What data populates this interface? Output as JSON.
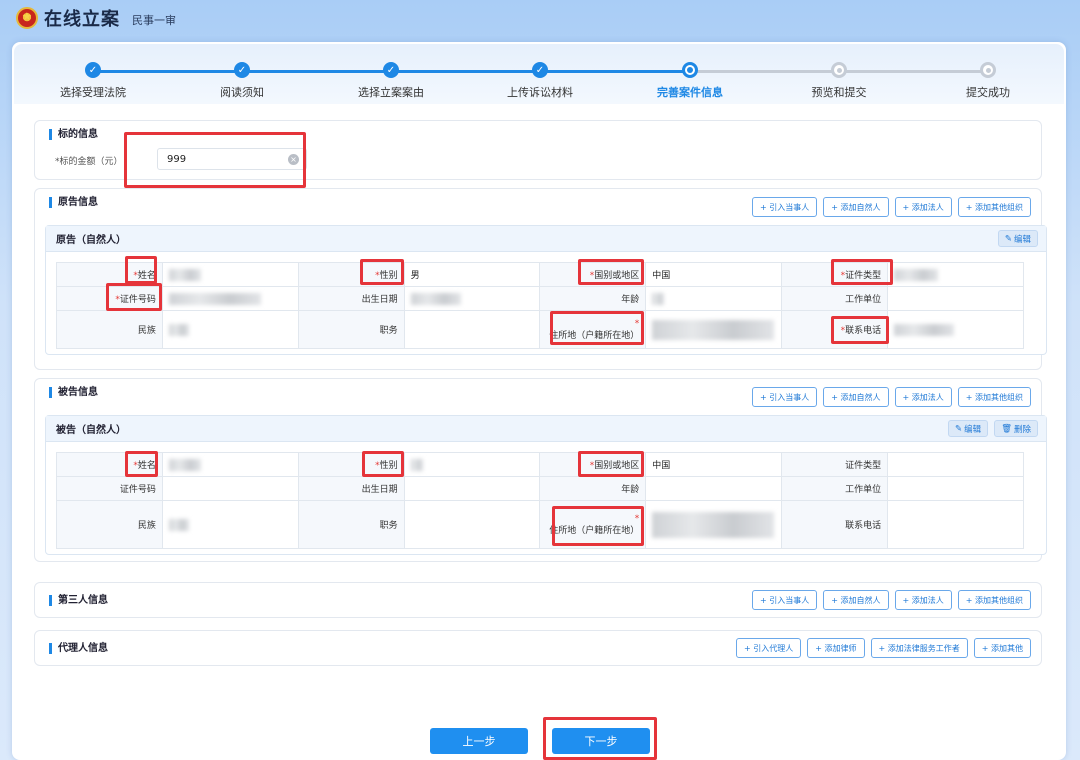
{
  "header": {
    "title": "在线立案",
    "subtitle": "民事一审"
  },
  "steps": [
    {
      "label": "选择受理法院",
      "state": "done"
    },
    {
      "label": "阅读须知",
      "state": "done"
    },
    {
      "label": "选择立案案由",
      "state": "done"
    },
    {
      "label": "上传诉讼材料",
      "state": "done"
    },
    {
      "label": "完善案件信息",
      "state": "current"
    },
    {
      "label": "预览和提交",
      "state": "todo"
    },
    {
      "label": "提交成功",
      "state": "todo"
    }
  ],
  "subject": {
    "title": "标的信息",
    "amount_label": "*标的金额（元）",
    "amount_value": "999"
  },
  "party_buttons": {
    "import": "+ 引入当事人",
    "add_natural": "+ 添加自然人",
    "add_legal": "+ 添加法人",
    "add_org": "+ 添加其他组织"
  },
  "plaintiff": {
    "section_title": "原告信息",
    "card_title": "原告（自然人）",
    "edit": "编辑",
    "labels": {
      "name": "姓名",
      "gender": "性别",
      "country": "国别或地区",
      "id_type": "证件类型",
      "id_no": "证件号码",
      "birth": "出生日期",
      "age": "年龄",
      "work": "工作单位",
      "ethnic": "民族",
      "job": "职务",
      "address": "住所地（户籍所在地）",
      "phone": "联系电话"
    },
    "values": {
      "gender": "男",
      "country": "中国"
    }
  },
  "defendant": {
    "section_title": "被告信息",
    "card_title": "被告（自然人）",
    "edit": "编辑",
    "delete": "删除",
    "labels": {
      "name": "姓名",
      "gender": "性别",
      "country": "国别或地区",
      "id_type": "证件类型",
      "id_no": "证件号码",
      "birth": "出生日期",
      "age": "年龄",
      "work": "工作单位",
      "ethnic": "民族",
      "job": "职务",
      "address": "住所地（户籍所在地）",
      "phone": "联系电话"
    },
    "values": {
      "country": "中国"
    }
  },
  "third_party": {
    "title": "第三人信息"
  },
  "agent": {
    "title": "代理人信息",
    "buttons": {
      "import": "+ 引入代理人",
      "lawyer": "+ 添加律师",
      "legal_worker": "+ 添加法律服务工作者",
      "other": "+ 添加其他"
    }
  },
  "nav": {
    "prev": "上一步",
    "next": "下一步"
  }
}
